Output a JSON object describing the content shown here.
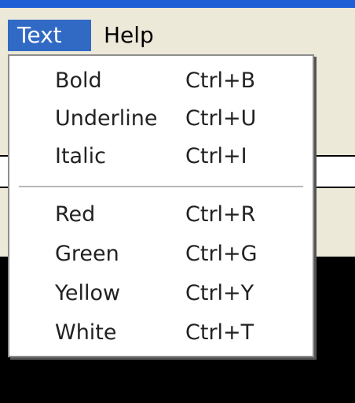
{
  "menubar": {
    "items": [
      {
        "label": "Text",
        "active": true
      },
      {
        "label": "Help",
        "active": false
      }
    ]
  },
  "text_menu": {
    "groups": [
      [
        {
          "label": "Bold",
          "shortcut": "Ctrl+B"
        },
        {
          "label": "Underline",
          "shortcut": "Ctrl+U"
        },
        {
          "label": "Italic",
          "shortcut": "Ctrl+I"
        }
      ],
      [
        {
          "label": "Red",
          "shortcut": "Ctrl+R"
        },
        {
          "label": "Green",
          "shortcut": "Ctrl+G"
        },
        {
          "label": "Yellow",
          "shortcut": "Ctrl+Y"
        },
        {
          "label": "White",
          "shortcut": "Ctrl+T"
        }
      ]
    ]
  },
  "colors": {
    "menubar_bg": "#ece9d8",
    "active_menu_bg": "#316ac5",
    "menu_bg": "#ffffff",
    "window_frame": "#1f5fd6"
  }
}
